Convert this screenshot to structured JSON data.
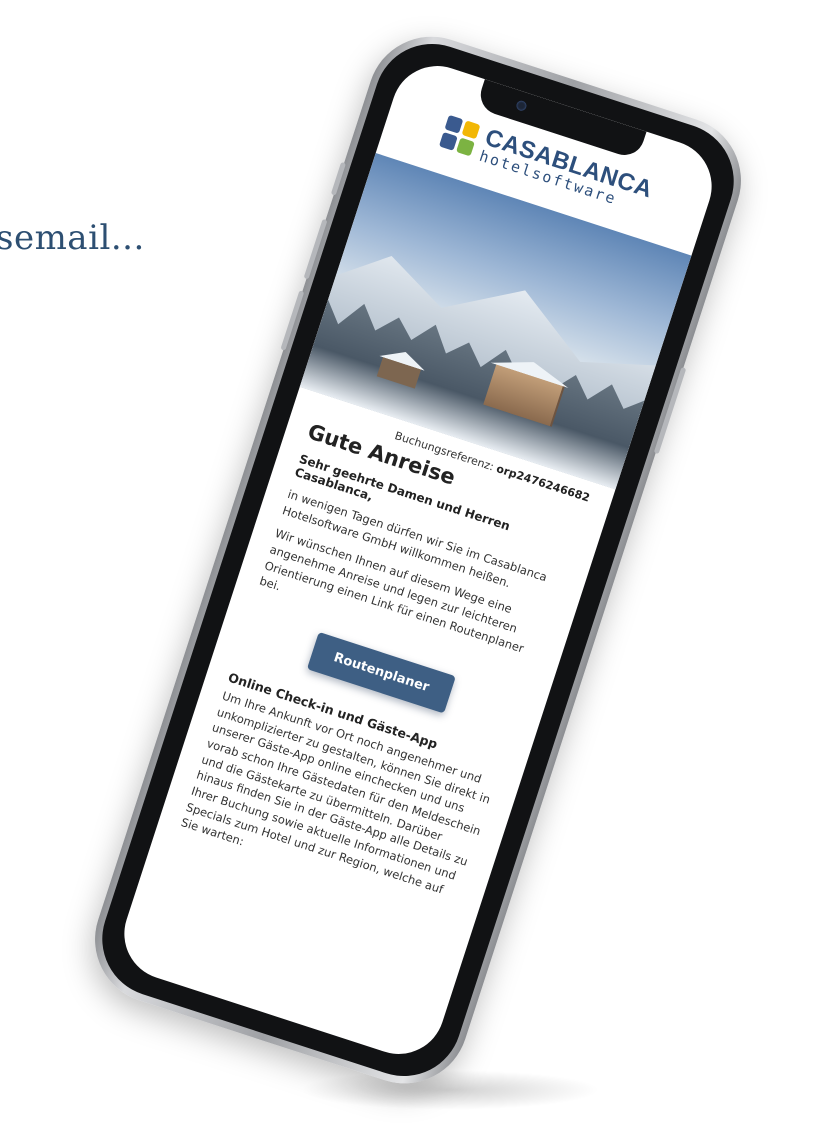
{
  "intro_text": "semail...",
  "email": {
    "logo": {
      "name": "CASABLANCA",
      "sub": "hotelsoftware"
    },
    "booking_label": "Buchungsreferenz: ",
    "booking_code": "orp2476246682",
    "heading": "Gute Anreise",
    "greeting": "Sehr geehrte Damen und Herren Casablanca,",
    "para1": "in wenigen Tagen dürfen wir Sie im Casablanca Hotelsoftware GmbH willkommen heißen.",
    "para2": "Wir wünschen Ihnen auf diesem Wege eine angenehme Anreise und legen zur leichteren Orientierung einen Link für einen Routenplaner bei.",
    "cta_label": "Routenplaner",
    "section_title": "Online Check-in und Gäste-App",
    "section_text": "Um Ihre Ankunft vor Ort noch angenehmer und unkomplizierter zu gestalten, können Sie direkt in unserer Gäste-App online einchecken und uns vorab schon Ihre Gästedaten für den Meldeschein und die Gästekarte zu übermitteln. Darüber hinaus finden Sie in der Gäste-App alle Details zu Ihrer Buchung sowie aktuelle Informationen und Specials zum Hotel und zur Region, welche auf Sie warten:"
  },
  "colors": {
    "brand_blue": "#2d4f7c",
    "button": "#3e5f84",
    "logo_yellow": "#f2b705",
    "logo_green": "#7cb342"
  }
}
